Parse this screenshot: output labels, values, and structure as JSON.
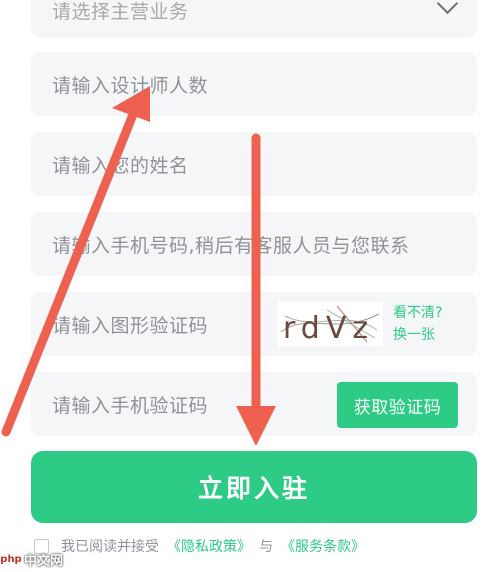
{
  "form": {
    "business_placeholder": "请选择主营业务",
    "designers_placeholder": "请输入设计师人数",
    "name_placeholder": "请输入您的姓名",
    "phone_placeholder": "请输入手机号码,稍后有客服人员与您联系",
    "captcha_placeholder": "请输入图形验证码",
    "captcha_text": "rdVz",
    "captcha_refresh_line1": "看不清?",
    "captcha_refresh_line2": "换一张",
    "sms_placeholder": "请输入手机验证码",
    "sms_button": "获取验证码",
    "submit": "立即入驻"
  },
  "agreement": {
    "prefix": "我已阅读并接受",
    "privacy": "《隐私政策》",
    "and": "与",
    "terms": "《服务条款》"
  },
  "watermark": {
    "logo": "php",
    "site": "中文网"
  },
  "colors": {
    "accent": "#2ecb86",
    "annotation_arrow": "#ee6150"
  }
}
